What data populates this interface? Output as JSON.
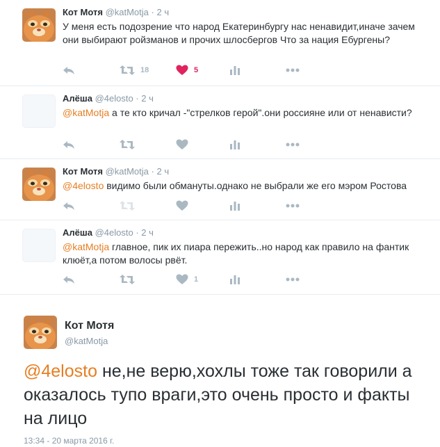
{
  "tweets": [
    {
      "name": "Кот Мотя",
      "handle": "@katMotja",
      "dot": "·",
      "time": "2 ч",
      "mention": "",
      "text": "У меня есть подозрение что народ Екатеринбургу нас ненавидит,иначе зачем они  выбирают ройзманов и прочих шлосбергов Что за нация Ебургены?",
      "retweets": "18",
      "likes": "5",
      "liked": true
    },
    {
      "name": "Алёша",
      "handle": "@4elosto",
      "dot": "·",
      "time": "2 ч",
      "mention": "@katMotja",
      "text": " а те кто кричал -\"стрелков герой\".они россияне или от ненависти?",
      "retweets": "",
      "likes": "",
      "liked": false
    },
    {
      "name": "Кот Мотя",
      "handle": "@katMotja",
      "dot": "·",
      "time": "2 ч",
      "mention": "@4elosto",
      "text": " видимо были обмануты.однако не выбрали же его мэром Ростова",
      "retweets": "",
      "likes": "",
      "liked": false
    },
    {
      "name": "Алёша",
      "handle": "@4elosto",
      "dot": "·",
      "time": "2 ч",
      "mention": "@katMotja",
      "text": " главное, пик их пиара пережить..но народ как правило на фантик клюёт,а потом волосы рвёт.",
      "retweets": "",
      "likes": "1",
      "liked": false
    }
  ],
  "focused": {
    "name": "Кот Мотя",
    "handle": "@katMotja",
    "mention": "@4elosto",
    "text": " не,не верю,хохлы тоже так говорили а оказалось тупо враги,это очень просто и факты на лицо",
    "timestamp": "13:34 - 20 марта 2016 г."
  },
  "icons": {
    "reply": "reply-icon",
    "retweet": "retweet-icon",
    "like": "heart-icon",
    "analytics": "analytics-icon",
    "more": "more-icon"
  },
  "colors": {
    "mention": "#e67e22",
    "like_active": "#e0245e",
    "icon": "#aab8c2",
    "muted": "#8899a6"
  }
}
